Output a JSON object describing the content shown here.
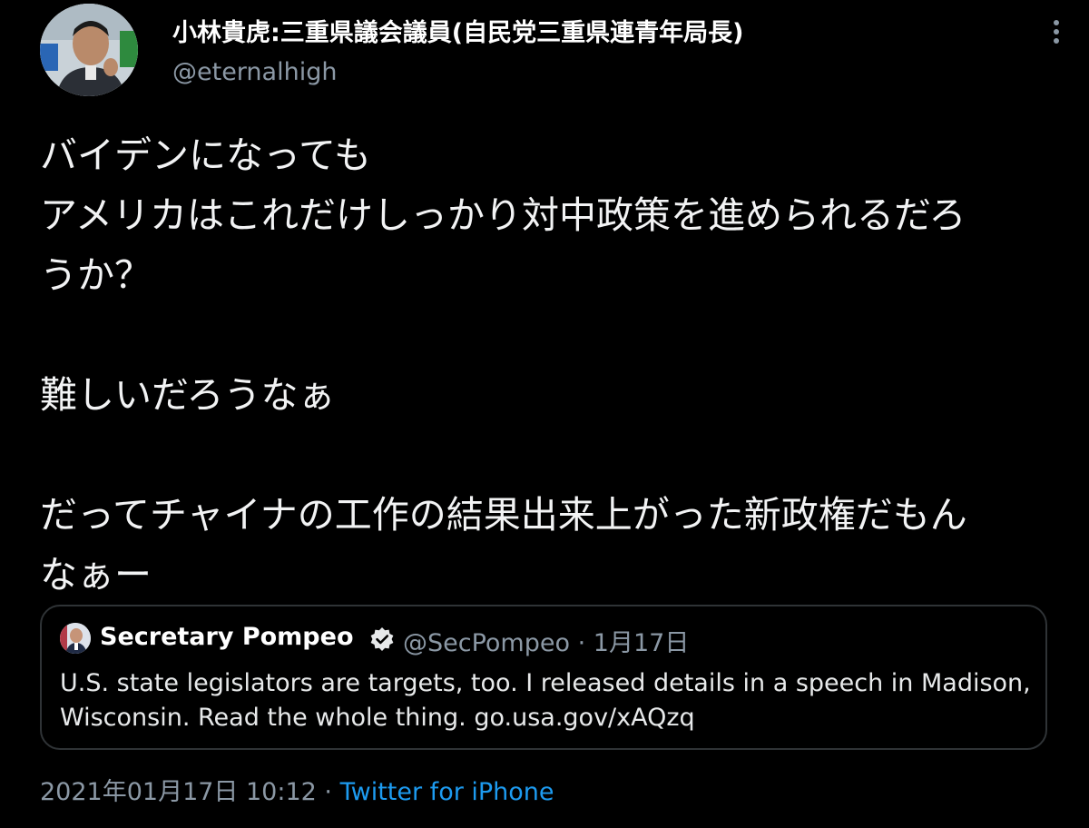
{
  "author": {
    "display_name": "小林貴虎:三重県議会議員(自民党三重県連青年局長)",
    "handle": "@eternalhigh",
    "avatar_icon": "profile-photo"
  },
  "tweet": {
    "text": "バイデンになっても\nアメリカはこれだけしっかり対中政策を進められるだろ\nうか？\n\n難しいだろうなぁ\n\nだってチャイナの工作の結果出来上がった新政権だもん\nなぁー"
  },
  "quoted_tweet": {
    "display_name": "Secretary Pompeo",
    "verified_icon": "verified-badge",
    "handle": "@SecPompeo",
    "separator": "·",
    "date": "1月17日",
    "text": "U.S. state legislators are targets, too. I released details in a speech in Madison, Wisconsin. Read the whole thing. go.usa.gov/xAQzq"
  },
  "footer": {
    "timestamp": "2021年01月17日 10:12",
    "separator": "·",
    "client": "Twitter for iPhone"
  },
  "menu_icon": "more-vertical",
  "colors": {
    "background": "#000000",
    "text_primary": "#f2f3f4",
    "text_secondary": "#8b98a5",
    "link": "#1d9bf0",
    "border": "#2f3336"
  }
}
